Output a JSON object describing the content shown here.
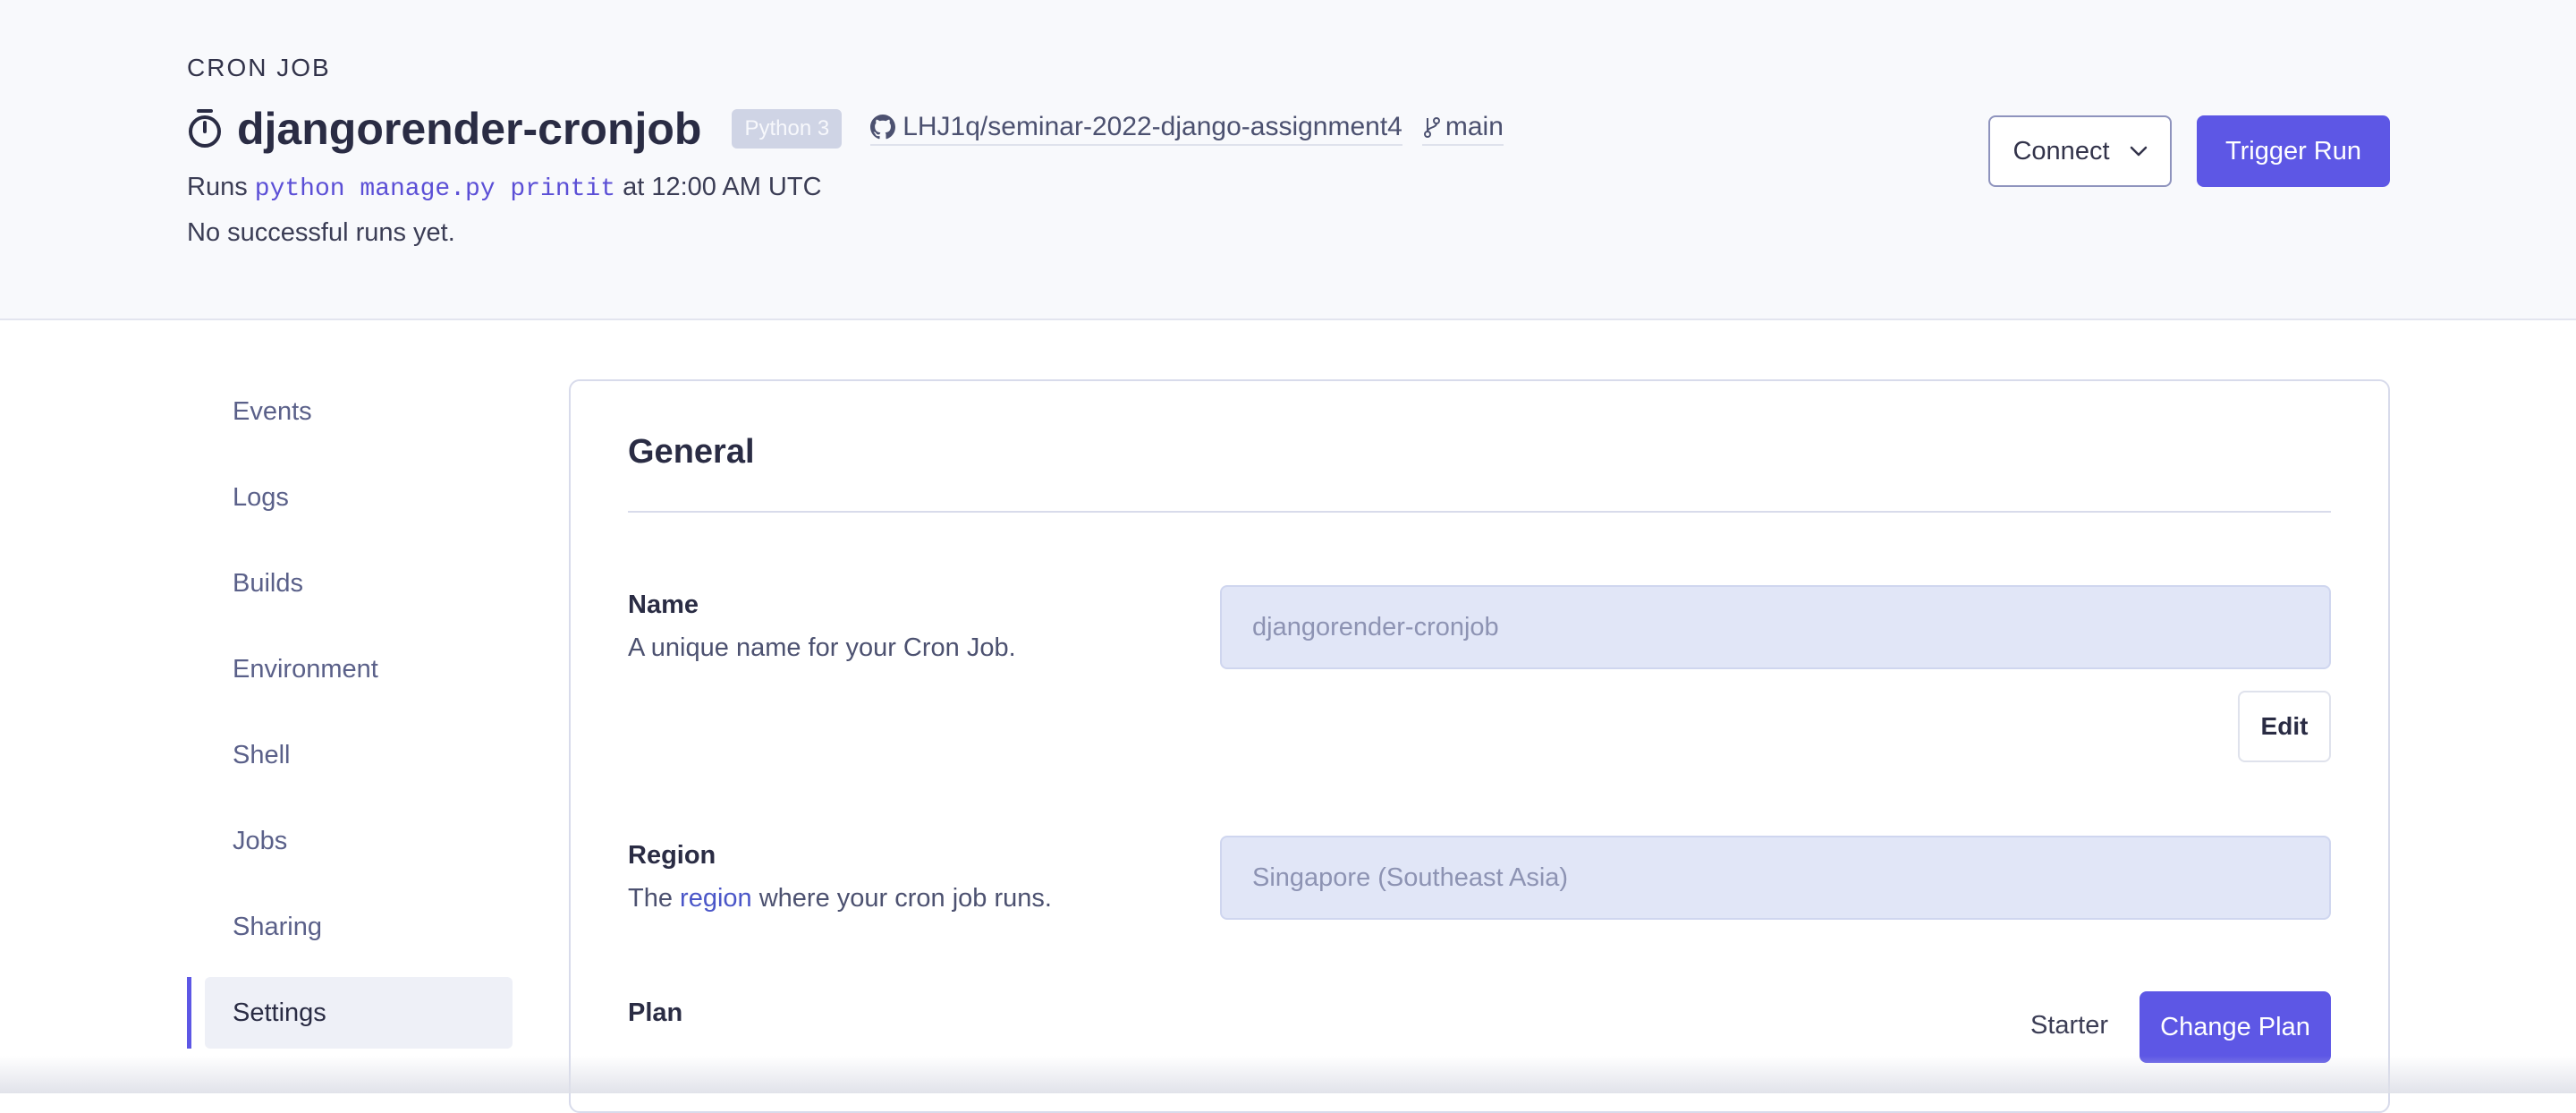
{
  "header": {
    "kind": "CRON JOB",
    "service_name": "djangorender-cronjob",
    "runtime_badge": "Python 3",
    "repo": "LHJ1q/seminar-2022-django-assignment4",
    "branch": "main",
    "runs_prefix": "Runs",
    "command": "python manage.py printit",
    "schedule_text": "at 12:00 AM UTC",
    "status_text": "No successful runs yet.",
    "connect_label": "Connect",
    "trigger_label": "Trigger Run"
  },
  "sidebar": {
    "items": [
      {
        "label": "Events"
      },
      {
        "label": "Logs"
      },
      {
        "label": "Builds"
      },
      {
        "label": "Environment"
      },
      {
        "label": "Shell"
      },
      {
        "label": "Jobs"
      },
      {
        "label": "Sharing"
      },
      {
        "label": "Settings",
        "active": true
      }
    ]
  },
  "general": {
    "title": "General",
    "name": {
      "label": "Name",
      "description": "A unique name for your Cron Job.",
      "value": "djangorender-cronjob",
      "edit_label": "Edit"
    },
    "region": {
      "label": "Region",
      "desc_prefix": "The",
      "desc_link": "region",
      "desc_suffix": "where your cron job runs.",
      "value": "Singapore (Southeast Asia)"
    },
    "plan": {
      "label": "Plan",
      "value": "Starter",
      "change_label": "Change Plan"
    }
  },
  "colors": {
    "accent": "#5d57e5",
    "header_bg": "#f8f9fc",
    "input_bg": "#e1e6f7",
    "code_text": "#5b4fd6"
  }
}
